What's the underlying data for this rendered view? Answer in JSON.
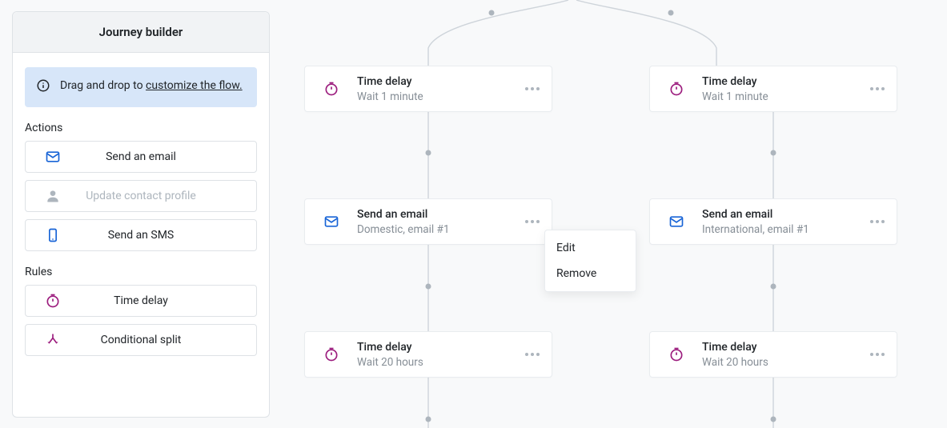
{
  "sidebar": {
    "title": "Journey builder",
    "info_prefix": "Drag and drop to ",
    "info_link": "customize the flow.",
    "actions_label": "Actions",
    "actions": [
      {
        "label": "Send an email"
      },
      {
        "label": "Update contact profile"
      },
      {
        "label": "Send an SMS"
      }
    ],
    "rules_label": "Rules",
    "rules": [
      {
        "label": "Time delay"
      },
      {
        "label": "Conditional split"
      }
    ]
  },
  "flow": {
    "left": [
      {
        "title": "Time delay",
        "sub": "Wait 1 minute"
      },
      {
        "title": "Send an email",
        "sub": "Domestic, email #1"
      },
      {
        "title": "Time delay",
        "sub": "Wait 20 hours"
      }
    ],
    "right": [
      {
        "title": "Time delay",
        "sub": "Wait 1 minute"
      },
      {
        "title": "Send an email",
        "sub": "International, email #1"
      },
      {
        "title": "Time delay",
        "sub": "Wait 20 hours"
      }
    ]
  },
  "popup": {
    "edit": "Edit",
    "remove": "Remove"
  }
}
